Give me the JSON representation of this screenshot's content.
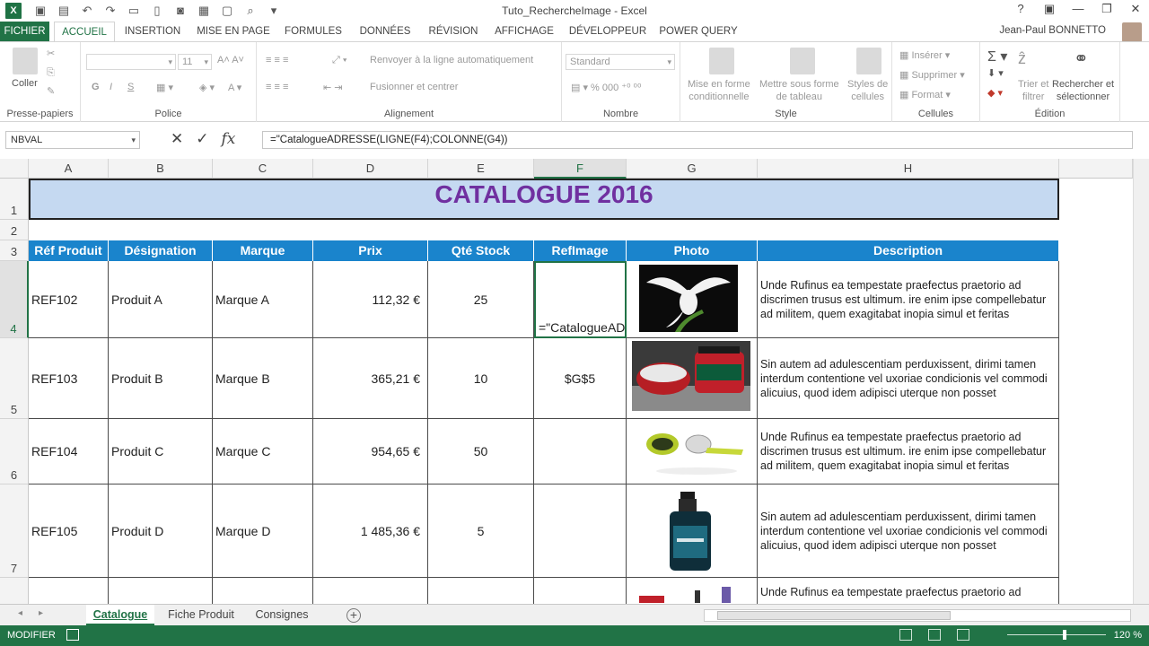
{
  "window": {
    "title": "Tuto_RechercheImage - Excel",
    "user": "Jean-Paul BONNETTO"
  },
  "tabs": [
    "FICHIER",
    "ACCUEIL",
    "INSERTION",
    "MISE EN PAGE",
    "FORMULES",
    "DONNÉES",
    "RÉVISION",
    "AFFICHAGE",
    "DÉVELOPPEUR",
    "POWER QUERY"
  ],
  "ribbon": {
    "clipboard": {
      "paste": "Coller",
      "label": "Presse-papiers"
    },
    "font": {
      "size": "11",
      "bold": "G",
      "italic": "I",
      "underline": "S",
      "label": "Police"
    },
    "alignment": {
      "wrap": "Renvoyer à la ligne automatiquement",
      "merge": "Fusionner et centrer",
      "label": "Alignement"
    },
    "number": {
      "format": "Standard",
      "label": "Nombre"
    },
    "styles": {
      "conditional": "Mise en forme\nconditionnelle",
      "table": "Mettre sous forme\nde tableau",
      "cellstyles": "Styles de\ncellules",
      "label": "Style"
    },
    "cells": {
      "insert": "Insérer",
      "delete": "Supprimer",
      "format": "Format",
      "label": "Cellules"
    },
    "editing": {
      "sort": "Trier et\nfiltrer",
      "find": "Rechercher et\nsélectionner",
      "label": "Édition"
    }
  },
  "formula_bar": {
    "name_box": "NBVAL",
    "formula": "=\"CatalogueADRESSE(LIGNE(F4);COLONNE(G4))"
  },
  "columns": [
    "A",
    "B",
    "C",
    "D",
    "E",
    "F",
    "G",
    "H"
  ],
  "rows": [
    "1",
    "2",
    "3",
    "4",
    "5",
    "6",
    "7"
  ],
  "banner": "CATALOGUE 2016",
  "table_headers": [
    "Réf Produit",
    "Désignation",
    "Marque",
    "Prix",
    "Qté Stock",
    "RefImage",
    "Photo",
    "Description"
  ],
  "products": [
    {
      "ref": "REF102",
      "name": "Produit A",
      "brand": "Marque A",
      "price": "112,32 €",
      "stock": "25",
      "refimage": "=\"CatalogueAD",
      "desc": "Unde Rufinus ea tempestate praefectus praetorio ad discrimen trusus est ultimum. ire enim ipse compellebatur ad militem, quem exagitabat inopia simul et feritas"
    },
    {
      "ref": "REF103",
      "name": "Produit B",
      "brand": "Marque B",
      "price": "365,21 €",
      "stock": "10",
      "refimage": "$G$5",
      "desc": "Sin autem ad adulescentiam perduxissent, dirimi tamen interdum contentione vel uxoriae condicionis vel commodi alicuius, quod idem adipisci uterque non posset"
    },
    {
      "ref": "REF104",
      "name": "Produit C",
      "brand": "Marque C",
      "price": "954,65 €",
      "stock": "50",
      "refimage": "",
      "desc": "Unde Rufinus ea tempestate praefectus praetorio ad discrimen trusus est ultimum. ire enim ipse compellebatur ad militem, quem exagitabat inopia simul et feritas"
    },
    {
      "ref": "REF105",
      "name": "Produit D",
      "brand": "Marque D",
      "price": "1 485,36 €",
      "stock": "5",
      "refimage": "",
      "desc": "Sin autem ad adulescentiam perduxissent, dirimi tamen interdum contentione vel uxoriae condicionis vel commodi alicuius, quod idem adipisci uterque non posset"
    },
    {
      "ref": "",
      "name": "",
      "brand": "",
      "price": "",
      "stock": "",
      "refimage": "",
      "desc": "Unde Rufinus ea tempestate praefectus praetorio ad"
    }
  ],
  "sheets": [
    "Catalogue",
    "Fiche Produit",
    "Consignes"
  ],
  "status": {
    "mode": "MODIFIER",
    "zoom": "120 %"
  },
  "colors": {
    "excel_green": "#217346",
    "header_blue": "#1a84cc",
    "banner_bg": "#c5d9f1",
    "banner_text": "#7030a0"
  }
}
